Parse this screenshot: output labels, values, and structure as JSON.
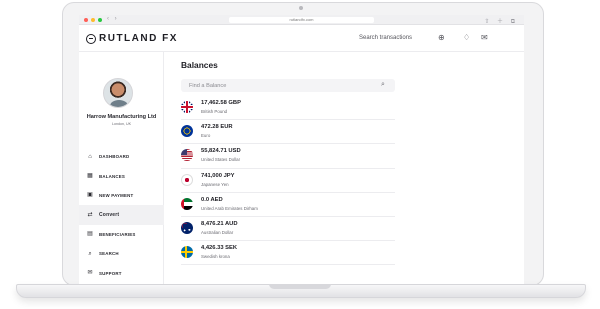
{
  "browser": {
    "url": "rutlandfx.com"
  },
  "brand": {
    "name": "RUTLAND FX"
  },
  "topbar": {
    "search_label": "Search transactions"
  },
  "profile": {
    "company": "Harrow Manufacturing Ltd",
    "location": "London, UK"
  },
  "menu": [
    {
      "label": "DASHBOARD",
      "icon": "home-icon",
      "active": false
    },
    {
      "label": "BALANCES",
      "icon": "calculator-icon",
      "active": false
    },
    {
      "label": "NEW PAYMENT",
      "icon": "payment-icon",
      "active": false
    },
    {
      "label": "Convert",
      "icon": "exchange-icon",
      "active": true
    },
    {
      "label": "BENEFICIARIES",
      "icon": "beneficiaries-icon",
      "active": false
    },
    {
      "label": "SEARCH",
      "icon": "search-icon",
      "active": false
    },
    {
      "label": "SUPPORT",
      "icon": "support-icon",
      "active": false
    }
  ],
  "main": {
    "title": "Balances",
    "find_placeholder": "Find a Balance",
    "balances": [
      {
        "amount": "17,462.58 GBP",
        "name": "British Pound",
        "flag": "uk"
      },
      {
        "amount": "472.28 EUR",
        "name": "Euro",
        "flag": "eu"
      },
      {
        "amount": "55,824.71 USD",
        "name": "United States Dollar",
        "flag": "us"
      },
      {
        "amount": "741,000 JPY",
        "name": "Japanese Yen",
        "flag": "jp"
      },
      {
        "amount": "0.0 AED",
        "name": "United Arab Emirates Dirham",
        "flag": "ae"
      },
      {
        "amount": "8,476.21 AUD",
        "name": "Australian Dollar",
        "flag": "au"
      },
      {
        "amount": "4,426.33 SEK",
        "name": "Swedish krona",
        "flag": "se"
      }
    ]
  },
  "colors": {
    "accent": "#1e1e24",
    "active_bg": "#f1f1f3",
    "row_divider": "#ececef"
  }
}
